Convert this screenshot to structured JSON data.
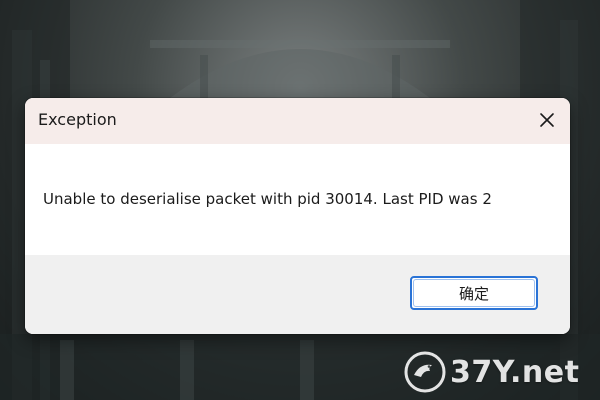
{
  "dialog": {
    "title": "Exception",
    "message": "Unable to deserialise packet with pid 30014. Last PID was 2",
    "ok_label": "确定",
    "close_icon": "close-icon"
  },
  "watermark": {
    "text": "37Y.net",
    "logo_icon": "bird-logo-icon"
  },
  "colors": {
    "titlebar_bg": "#f6ecea",
    "content_bg": "#ffffff",
    "footer_bg": "#f0f0f0",
    "button_border": "#2a73d6"
  }
}
